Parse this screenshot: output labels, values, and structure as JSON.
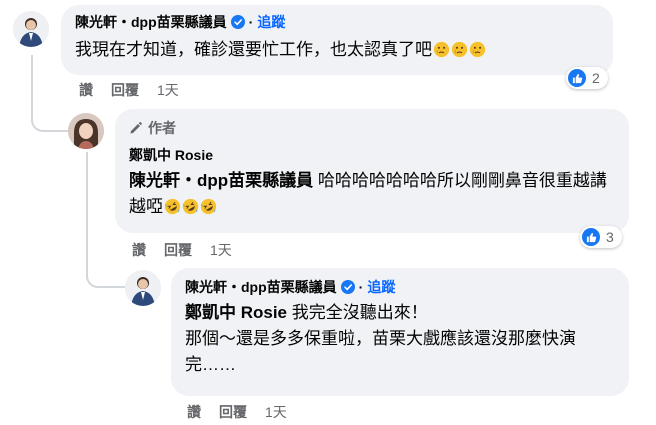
{
  "comment1": {
    "name": "陳光軒・dpp苗栗縣議員",
    "follow": "追蹤",
    "text": "我現在才知道，確診還要忙工作，也太認真了吧",
    "emoji": "crying-face-icon",
    "actions": {
      "like": "讚",
      "reply": "回覆",
      "time": "1天"
    },
    "reaction_count": "2"
  },
  "comment2": {
    "author_tag": "作者",
    "name": "鄭凱中 Rosie",
    "mention": "陳光軒・dpp苗栗縣議員",
    "text": " 哈哈哈哈哈哈哈所以剛剛鼻音很重越講越啞",
    "emoji": "rolling-laughing-icon",
    "actions": {
      "like": "讚",
      "reply": "回覆",
      "time": "1天"
    },
    "reaction_count": "3"
  },
  "comment3": {
    "name": "陳光軒・dpp苗栗縣議員",
    "follow": "追蹤",
    "mention": "鄭凱中 Rosie",
    "line1": " 我完全沒聽出來！",
    "line2": "那個～還是多多保重啦，苗栗大戲應該還沒那麼快演完……",
    "actions": {
      "like": "讚",
      "reply": "回覆",
      "time": "1天"
    }
  },
  "colors": {
    "bubble": "#f0f2f5",
    "link": "#0866ff",
    "meta": "#65676b",
    "like_blue": "#1877f2"
  }
}
